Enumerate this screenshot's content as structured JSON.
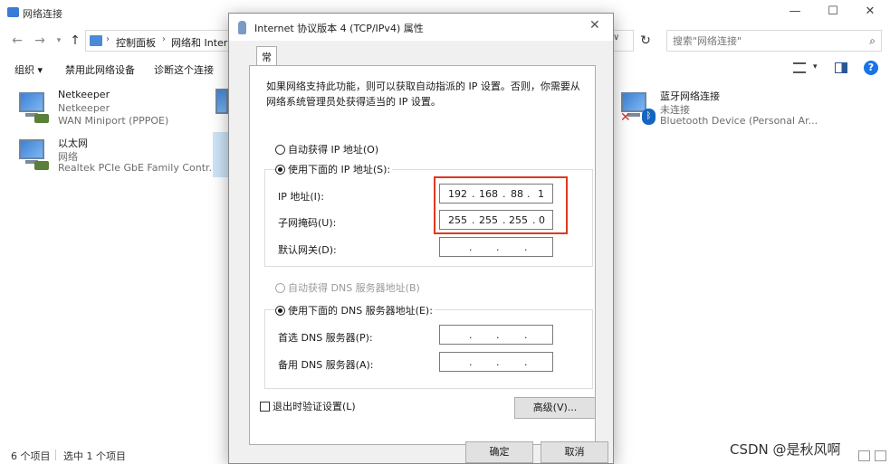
{
  "explorer": {
    "title": "网络连接",
    "breadcrumbs": [
      "控制面板",
      "网络和 Internet"
    ],
    "search_placeholder": "搜索\"网络连接\"",
    "commands": {
      "organize": "组织 ▾",
      "disable": "禁用此网络设备",
      "diagnose": "诊断这个连接"
    },
    "connections": [
      {
        "name": "Netkeeper",
        "status": "Netkeeper",
        "device": "WAN Miniport (PPPOE)"
      },
      {
        "name": "以太网",
        "status": "网络",
        "device": "Realtek PCIe GbE Family Contr..."
      },
      {
        "name": "蓝牙网络连接",
        "status": "未连接",
        "device": "Bluetooth Device (Personal Ar..."
      }
    ],
    "status": {
      "items": "6 个项目",
      "selected": "选中 1 个项目"
    },
    "watermark": "CSDN @是秋风啊"
  },
  "dialog": {
    "title": "Internet 协议版本 4 (TCP/IPv4) 属性",
    "tab": "常规",
    "intro": "如果网络支持此功能，则可以获取自动指派的 IP 设置。否则，你需要从网络系统管理员处获得适当的 IP 设置。",
    "auto_ip": "自动获得 IP 地址(O)",
    "manual_ip": "使用下面的 IP 地址(S):",
    "ip_label": "IP 地址(I):",
    "mask_label": "子网掩码(U):",
    "gateway_label": "默认网关(D):",
    "ip_address": [
      "192",
      "168",
      "88",
      "1"
    ],
    "subnet_mask": [
      "255",
      "255",
      "255",
      "0"
    ],
    "auto_dns": "自动获得 DNS 服务器地址(B)",
    "manual_dns": "使用下面的 DNS 服务器地址(E):",
    "preferred_dns_label": "首选 DNS 服务器(P):",
    "alternate_dns_label": "备用 DNS 服务器(A):",
    "validate_on_exit": "退出时验证设置(L)",
    "advanced": "高级(V)...",
    "ok": "确定",
    "cancel": "取消"
  },
  "colors": {
    "highlight": "#e0391f",
    "accent": "#1a73e8"
  }
}
